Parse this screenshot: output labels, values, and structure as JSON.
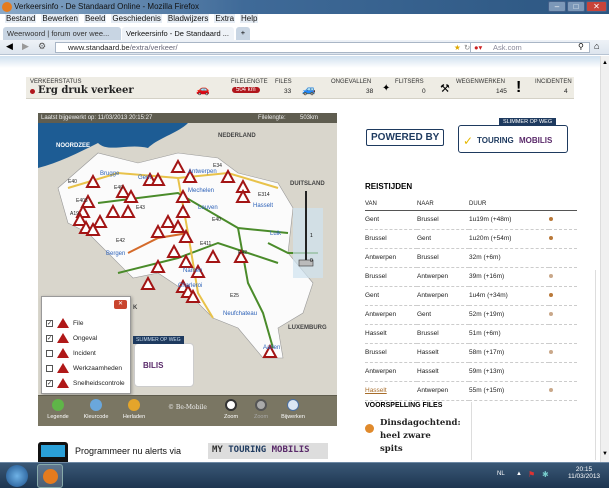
{
  "window": {
    "title": "Verkeersinfo - De Standaard Online - Mozilla Firefox"
  },
  "menu": [
    "Bestand",
    "Bewerken",
    "Beeld",
    "Geschiedenis",
    "Bladwijzers",
    "Extra",
    "Help"
  ],
  "tabs": [
    {
      "label": "Weerwoord | forum over wee...",
      "active": false
    },
    {
      "label": "Verkeersinfo - De Standaard ...",
      "active": true
    }
  ],
  "tab_new": "+",
  "nav": {
    "url_domain": "www.standaard.be",
    "url_path": "/extra/verkeer/",
    "search_placeholder": "Ask.com"
  },
  "status": {
    "label": "VERKEERSTATUS",
    "value": "Erg druk verkeer",
    "dot_color": "#b0161c",
    "stats": [
      {
        "label": "FILELENGTE",
        "value": "504 km",
        "badge": true
      },
      {
        "label": "FILES",
        "value": "33"
      },
      {
        "label": "ONGEVALLEN",
        "value": "38"
      },
      {
        "label": "FLITSERS",
        "value": "0"
      },
      {
        "label": "WEGENWERKEN",
        "value": "145"
      },
      {
        "label": "INCIDENTEN",
        "value": "4"
      }
    ]
  },
  "map": {
    "updated_label": "Laatst bijgewerkt op:",
    "updated": "11/03/2013  20:15:27",
    "filelength_label": "Filelengte:",
    "filelength": "503km",
    "labels": {
      "sea": "NOORDZEE",
      "nl": "NEDERLAND",
      "de": "DUITSLAND",
      "lux": "LUXEMBURG",
      "k": "K"
    },
    "cities": [
      "Brugge",
      "Gent",
      "Mechelen",
      "Leuven",
      "Hasselt",
      "Luik",
      "Bergen",
      "Namen",
      "Charleroi",
      "Neufchateau",
      "Aarlen",
      "Antwerpen"
    ],
    "roads": [
      "E40",
      "E40",
      "E403",
      "A19",
      "E34",
      "E314",
      "E42",
      "E411",
      "E25",
      "E42",
      "E40",
      "E411",
      "E43"
    ],
    "zoom_scale": [
      "1",
      "0"
    ],
    "legend": {
      "close": "✕",
      "items": [
        {
          "label": "File",
          "checked": true
        },
        {
          "label": "Ongeval",
          "checked": true
        },
        {
          "label": "Incident",
          "checked": false
        },
        {
          "label": "Werkzaamheden",
          "checked": false
        },
        {
          "label": "Snelheidscontrole",
          "checked": true
        }
      ]
    },
    "footer": {
      "buttons": [
        "Legende",
        "Kleurcode",
        "Herladen"
      ],
      "copyright": "© Be-Mobile",
      "zoom_in": "Zoom",
      "zoom_out": "Zoom",
      "refresh": "Bijwerken"
    }
  },
  "ad": {
    "tagline": "SLIMMER OP WEG",
    "powered": "POWERED BY",
    "brand1": "TOURING",
    "brand2": "MOBILIS",
    "partial": "BILIS",
    "check": "✓"
  },
  "reistijden": {
    "title": "REISTIJDEN",
    "headers": [
      "VAN",
      "NAAR",
      "DUUR"
    ],
    "rows": [
      {
        "van": "Gent",
        "naar": "Brussel",
        "duur": "1u19m (+48m)",
        "dot": "#b9793a"
      },
      {
        "van": "Brussel",
        "naar": "Gent",
        "duur": "1u20m (+54m)",
        "dot": "#b9793a"
      },
      {
        "van": "Antwerpen",
        "naar": "Brussel",
        "duur": "32m (+6m)",
        "dot": ""
      },
      {
        "van": "Brussel",
        "naar": "Antwerpen",
        "duur": "39m (+16m)",
        "dot": "#c9a88a"
      },
      {
        "van": "Gent",
        "naar": "Antwerpen",
        "duur": "1u4m (+34m)",
        "dot": "#b9793a"
      },
      {
        "van": "Antwerpen",
        "naar": "Gent",
        "duur": "52m (+19m)",
        "dot": "#c9a88a"
      },
      {
        "van": "Hasselt",
        "naar": "Brussel",
        "duur": "51m (+6m)",
        "dot": ""
      },
      {
        "van": "Brussel",
        "naar": "Hasselt",
        "duur": "58m (+17m)",
        "dot": "#c9a88a"
      },
      {
        "van": "Antwerpen",
        "naar": "Hasselt",
        "duur": "59m (+13m)",
        "dot": ""
      },
      {
        "van": "Hasselt",
        "naar": "Antwerpen",
        "duur": "55m (+15m)",
        "dot": "#c9a88a",
        "link": true
      }
    ]
  },
  "voorspelling": {
    "title": "VOORSPELLING FILES",
    "text1": "Dinsdagochtend:",
    "text2": "heel zware",
    "text3": "spits"
  },
  "promo": {
    "text": "Programmeer nu alerts via",
    "brand_my": "MY",
    "brand_touring": "TOURING",
    "brand_mobilis": "MOBILIS"
  },
  "taskbar": {
    "lang": "NL",
    "time": "20:15",
    "date": "11/03/2013"
  }
}
